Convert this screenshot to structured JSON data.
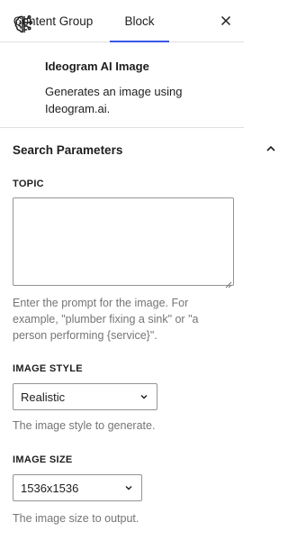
{
  "tabs": [
    {
      "label": "Content Group"
    },
    {
      "label": "Block"
    }
  ],
  "close_icon": "close-icon",
  "block": {
    "icon": "brain-icon",
    "title": "Ideogram AI Image",
    "description": "Generates an image using Ideogram.ai."
  },
  "panel": {
    "title": "Search Parameters",
    "expanded": true
  },
  "fields": {
    "topic": {
      "label": "TOPIC",
      "value": "",
      "help": "Enter the prompt for the image. For example, \"plumber fixing a sink\" or \"a person performing {service}\"."
    },
    "image_style": {
      "label": "IMAGE STYLE",
      "value": "Realistic",
      "help": "The image style to generate."
    },
    "image_size": {
      "label": "IMAGE SIZE",
      "value": "1536x1536",
      "help": "The image size to output."
    }
  },
  "colors": {
    "accent": "#3858e9",
    "border": "#e0e0e0",
    "help_text": "#757575"
  }
}
